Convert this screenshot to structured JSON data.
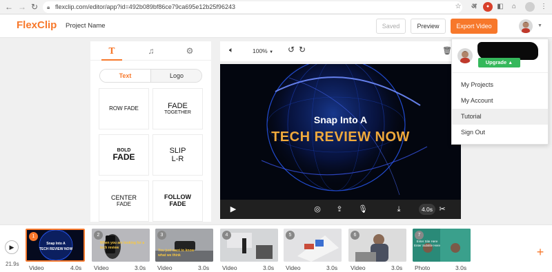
{
  "browser": {
    "url": "flexclip.com/editor/app?id=492b089bf86ce79ca695e12b25f96243",
    "icons": [
      "back-icon",
      "forward-icon",
      "reload-icon",
      "lock-icon",
      "star-icon",
      "translate-icon",
      "extension-icon",
      "tag-icon",
      "puzzle-icon",
      "profile-icon",
      "menu-icon"
    ]
  },
  "header": {
    "logo": "FlexClip",
    "project_name": "Project Name",
    "saved_label": "Saved",
    "preview_label": "Preview",
    "export_label": "Export Video",
    "accent_color": "#f7782b"
  },
  "left_panel": {
    "tabs": [
      "text-tab",
      "music-tab",
      "settings-tab"
    ],
    "segment": {
      "text": "Text",
      "logo": "Logo"
    },
    "presets": [
      {
        "line1": "ROW FADE",
        "line2": ""
      },
      {
        "line1": "FADE",
        "line2": "TOGETHER"
      },
      {
        "line1": "BOLD",
        "line2": "FADE"
      },
      {
        "line1": "SLIP",
        "line2": "L-R"
      },
      {
        "line1": "CENTER",
        "line2": "FADE"
      },
      {
        "line1": "FOLLOW",
        "line2": "FADE"
      }
    ]
  },
  "canvas_toolbar": {
    "zoom": "100%",
    "icons": [
      "volume-icon",
      "undo-icon",
      "redo-icon",
      "delete-icon"
    ]
  },
  "canvas": {
    "line1": "Snap Into A",
    "line2": "TECH REVIEW NOW",
    "line2_color": "#f0a93c"
  },
  "video_bar": {
    "duration": "4.0s",
    "icons": [
      "play-icon",
      "globe-icon",
      "upload-icon",
      "microphone-icon",
      "split-icon",
      "scissors-icon"
    ]
  },
  "dropdown": {
    "upgrade_label": "Upgrade",
    "items": [
      "My Projects",
      "My Account",
      "Tutorial",
      "Sign Out"
    ],
    "highlighted": "Tutorial"
  },
  "timeline": {
    "total_duration": "21.9s",
    "clips": [
      {
        "num": "1",
        "type": "Video",
        "duration": "4.0s",
        "active": true,
        "caption": "Snap Into A\nTECH REVIEW NOW"
      },
      {
        "num": "2",
        "type": "Video",
        "duration": "3.0s",
        "active": false,
        "caption": "When you are looking for a tech review"
      },
      {
        "num": "3",
        "type": "Video",
        "duration": "3.0s",
        "active": false,
        "caption": "You just want to know what we think"
      },
      {
        "num": "4",
        "type": "Video",
        "duration": "3.0s",
        "active": false,
        "caption": ""
      },
      {
        "num": "5",
        "type": "Video",
        "duration": "3.0s",
        "active": false,
        "caption": ""
      },
      {
        "num": "6",
        "type": "Video",
        "duration": "3.0s",
        "active": false,
        "caption": ""
      },
      {
        "num": "7",
        "type": "Photo",
        "duration": "3.0s",
        "active": false,
        "caption": "Enter Site Here\nEnter Subtitle Here"
      }
    ]
  }
}
